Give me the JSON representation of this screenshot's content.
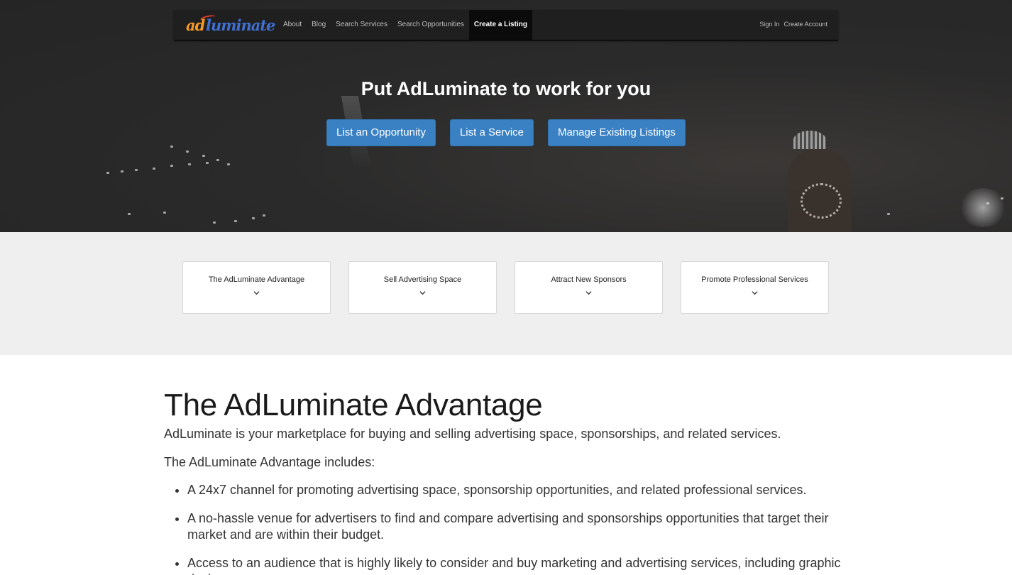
{
  "brand": {
    "logo_ad": "ad",
    "logo_rest": "luminate"
  },
  "nav": {
    "links": [
      "About",
      "Blog",
      "Search Services",
      "Search Opportunities",
      "Create a Listing"
    ],
    "active_index": 4,
    "sign_in": "Sign In",
    "create_account": "Create Account"
  },
  "hero": {
    "title": "Put AdLuminate to work for you",
    "buttons": [
      "List an Opportunity",
      "List a Service",
      "Manage Existing Listings"
    ]
  },
  "features": [
    "The AdLuminate Advantage",
    "Sell Advertising Space",
    "Attract New Sponsors",
    "Promote Professional Services"
  ],
  "content": {
    "heading": "The AdLuminate Advantage",
    "intro": "AdLuminate is your marketplace for buying and selling advertising space, sponsorships, and related services.",
    "subheading": "The AdLuminate Advantage includes:",
    "bullets": [
      "A 24x7 channel for promoting advertising space, sponsorship opportunities, and related professional services.",
      "A no-hassle venue for advertisers to find and compare advertising and sponsorships opportunities that target their market and are within their budget.",
      "Access to an audience that is highly likely to consider and buy marketing and advertising services, including graphic design,"
    ]
  },
  "colors": {
    "primary_button": "#3a81c4",
    "navbar": "#1f1f1f",
    "band": "#efefef"
  }
}
